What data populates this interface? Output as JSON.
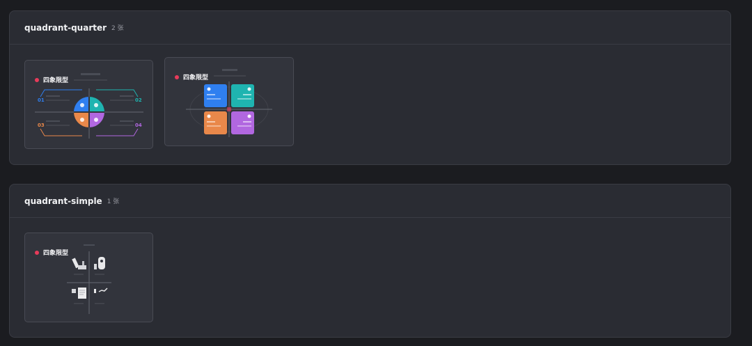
{
  "sections": [
    {
      "title": "quadrant-quarter",
      "count": "2 张",
      "cards": [
        {
          "title": "四象限型",
          "numbers": [
            "01",
            "02",
            "03",
            "04"
          ],
          "colors": [
            "#2f7ff0",
            "#1fb4b0",
            "#e9884a",
            "#b167e0"
          ]
        },
        {
          "title": "四象限型",
          "colors": [
            "#2f7ff0",
            "#1fb4b0",
            "#e9884a",
            "#b167e0"
          ]
        }
      ]
    },
    {
      "title": "quadrant-simple",
      "count": "1 张",
      "cards": [
        {
          "title": "四象限型"
        }
      ]
    }
  ],
  "icons": [
    "image-book-icon",
    "image-person-icon",
    "image-document-icon",
    "image-chart-icon"
  ]
}
